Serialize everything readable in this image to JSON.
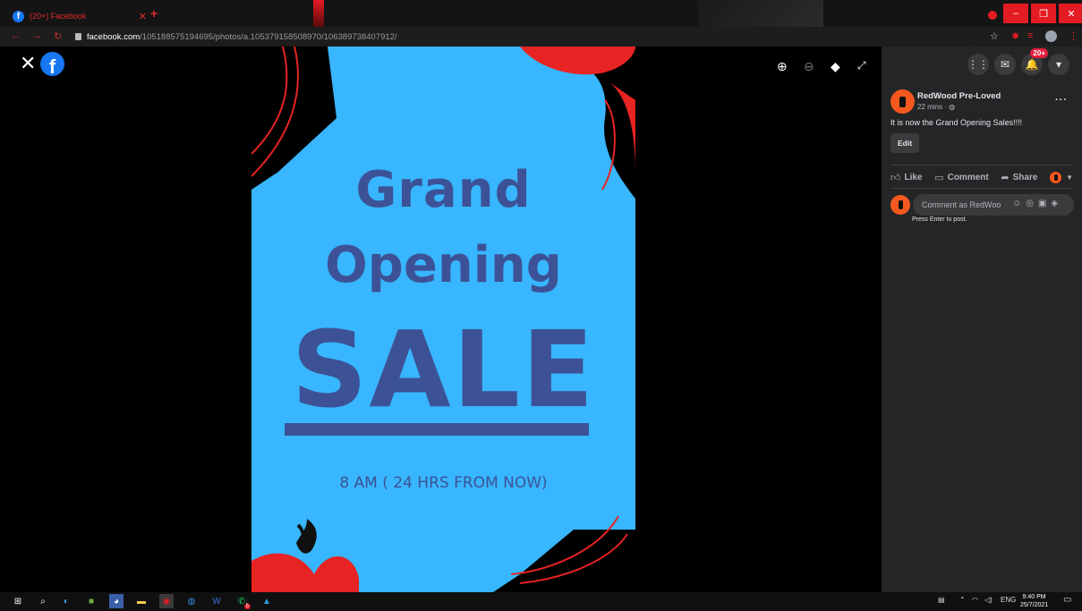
{
  "browser": {
    "tab_title": "(20+) Facebook",
    "url_host": "facebook.com",
    "url_path": "/105188575194695/photos/a.105379158508970/106389738407912/",
    "accent": "#e31b23"
  },
  "viewer": {
    "poster": {
      "line1": "Grand",
      "line2": "Opening",
      "line3": "SALE",
      "subtitle": "8 AM ( 24 HRS FROM NOW)",
      "bg_color": "#38b6ff",
      "text_color": "#3d5296",
      "flower_color": "#e82323"
    },
    "tools": [
      "zoom-in-icon",
      "zoom-out-icon",
      "tag-icon",
      "fullscreen-icon"
    ]
  },
  "header": {
    "notification_count": "20+"
  },
  "post": {
    "author": "RedWood Pre-Loved",
    "time": "22 mins · ",
    "text": "It is now the Grand Opening Sales!!!!",
    "edit_label": "Edit",
    "like_label": "Like",
    "comment_label": "Comment",
    "share_label": "Share",
    "comment_placeholder": "Comment as RedWoo...",
    "hint": "Press Enter to post."
  },
  "taskbar": {
    "time": "9:40 PM",
    "date": "25/7/2021",
    "lang": "ENG",
    "app_badge": "5"
  }
}
